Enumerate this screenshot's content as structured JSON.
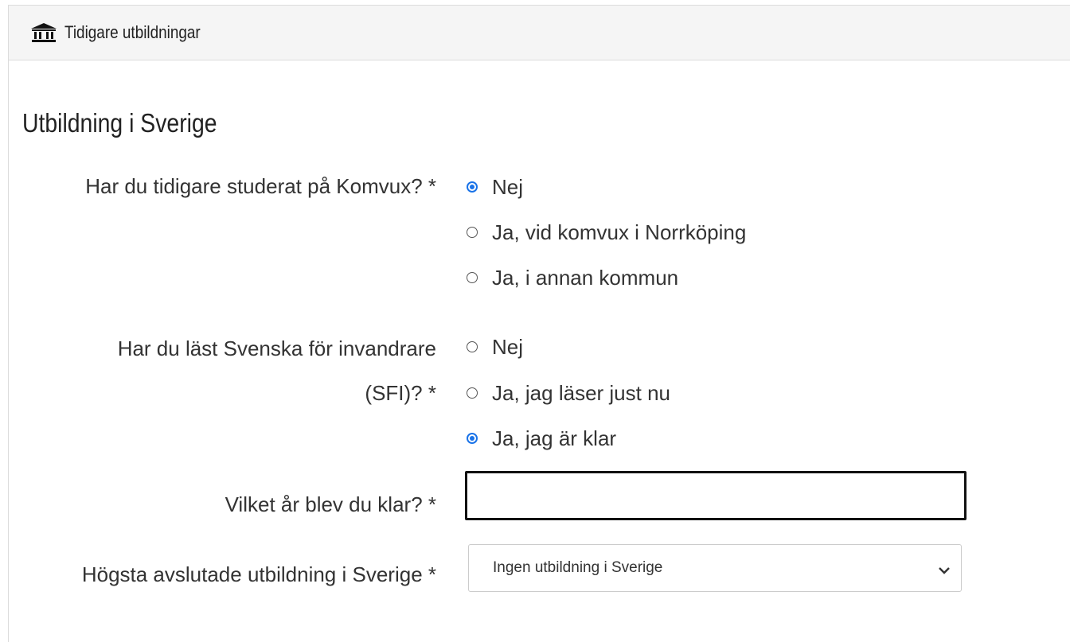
{
  "header": {
    "icon": "institution-icon",
    "title": "Tidigare utbildningar"
  },
  "section": {
    "title": "Utbildning i Sverige"
  },
  "komvux": {
    "label": "Har du tidigare studerat på Komvux? *",
    "options": [
      {
        "label": "Nej",
        "checked": true
      },
      {
        "label": "Ja, vid komvux i Norrköping",
        "checked": false
      },
      {
        "label": "Ja, i annan kommun",
        "checked": false
      }
    ]
  },
  "sfi": {
    "label_line1": "Har du läst Svenska för invandrare",
    "label_line2": "(SFI)? *",
    "options": [
      {
        "label": "Nej",
        "checked": false
      },
      {
        "label": "Ja, jag läser just nu",
        "checked": false
      },
      {
        "label": "Ja, jag är klar",
        "checked": true
      }
    ]
  },
  "year": {
    "label": "Vilket år blev du klar? *",
    "value": ""
  },
  "education": {
    "label": "Högsta avslutade utbildning i Sverige *",
    "selected": "Ingen utbildning i Sverige",
    "icon": "chevron-down-icon"
  },
  "colors": {
    "accent": "#1a73e8",
    "header_bg": "#f5f5f5"
  }
}
